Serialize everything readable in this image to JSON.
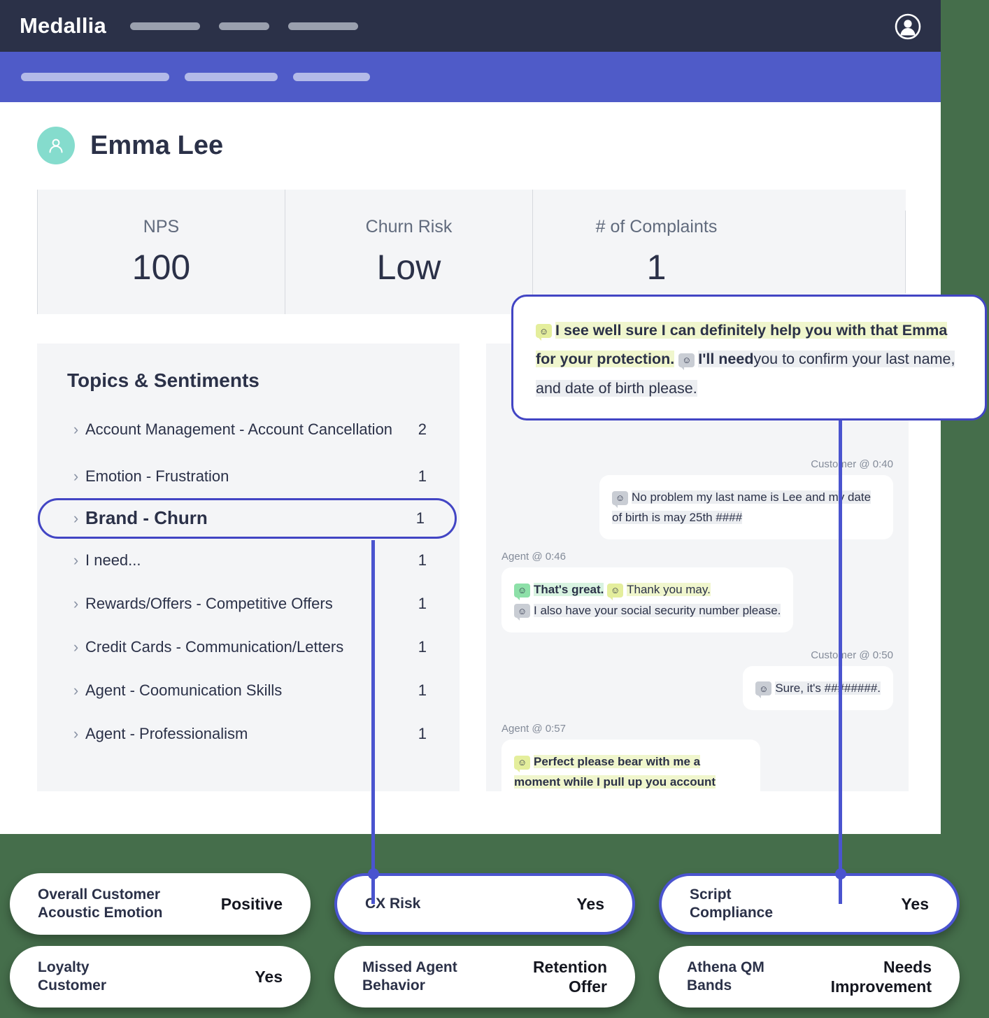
{
  "app": {
    "brand": "Medallia",
    "account_icon": "user-circle-icon",
    "nav_placeholders": 3,
    "subnav_placeholders": 3
  },
  "person": {
    "name": "Emma Lee",
    "avatar_icon": "person-icon"
  },
  "kpis": [
    {
      "label": "NPS",
      "value": "100"
    },
    {
      "label": "Churn Risk",
      "value": "Low"
    },
    {
      "label": "# of Complaints",
      "value": "1"
    }
  ],
  "topics_panel": {
    "title": "Topics & Sentiments",
    "expand_icon": "chevron-right-icon",
    "items": [
      {
        "label": "Account Management - Account Cancellation",
        "count": "2",
        "highlighted": false
      },
      {
        "label": "Emotion - Frustration",
        "count": "1",
        "highlighted": false
      },
      {
        "label": "Brand - Churn",
        "count": "1",
        "highlighted": true
      },
      {
        "label": "I need...",
        "count": "1",
        "highlighted": false
      },
      {
        "label": "Rewards/Offers - Competitive Offers",
        "count": "1",
        "highlighted": false
      },
      {
        "label": "Credit Cards - Communication/Letters",
        "count": "1",
        "highlighted": false
      },
      {
        "label": "Agent - Coomunication Skills",
        "count": "1",
        "highlighted": false
      },
      {
        "label": "Agent - Professionalism",
        "count": "1",
        "highlighted": false
      }
    ]
  },
  "callout": {
    "sentiment_icon": "smiley-chip-icon",
    "segments": [
      {
        "text": "I see well sure I can definitely help you with that Emma for your protection.",
        "style": "lime-bold"
      },
      {
        "text": "I'll need",
        "style": "grey-bold"
      },
      {
        "text": "you to confirm your last name, and date of birth please.",
        "style": "grey"
      }
    ],
    "full_text": "I see well sure I can definitely help you with that Emma for your protection. I'll need you to confirm your last name, and date of birth please."
  },
  "transcript": {
    "messages": [
      {
        "speaker": "Customer",
        "meta": "Customer @ 0:40",
        "side": "right",
        "lines": [
          {
            "chip": "grey",
            "text": "No problem my last name is Lee and my date of birth is may 25th ####",
            "style": "grey"
          }
        ]
      },
      {
        "speaker": "Agent",
        "meta": "Agent @ 0:46",
        "side": "left",
        "lines": [
          {
            "chip": "green",
            "text": "That's great.",
            "style": "green-bold"
          },
          {
            "chip": "lime",
            "text": "Thank you may.",
            "style": "lime"
          },
          {
            "chip": "grey",
            "text": "I also have your social security number please.",
            "style": "grey"
          }
        ]
      },
      {
        "speaker": "Customer",
        "meta": "Customer @ 0:50",
        "side": "right",
        "lines": [
          {
            "chip": "grey",
            "text": "Sure, it's ########.",
            "style": "grey"
          }
        ]
      },
      {
        "speaker": "Agent",
        "meta": "Agent @ 0:57",
        "side": "left",
        "lines": [
          {
            "chip": "lime",
            "text": "Perfect please bear with me a moment while I pull up you account",
            "style": "lime-bold"
          }
        ]
      }
    ]
  },
  "insight_pills": {
    "row1": [
      {
        "label": "Overall Customer\nAcoustic Emotion",
        "value": "Positive",
        "outlined": false
      },
      {
        "label": "CX Risk",
        "value": "Yes",
        "outlined": true
      },
      {
        "label": "Script\nCompliance",
        "value": "Yes",
        "outlined": true
      }
    ],
    "row2": [
      {
        "label": "Loyalty\nCustomer",
        "value": "Yes",
        "outlined": false
      },
      {
        "label": "Missed Agent\nBehavior",
        "value": "Retention\nOffer",
        "outlined": false
      },
      {
        "label": "Athena QM\nBands",
        "value": "Needs\nImprovement",
        "outlined": false
      }
    ]
  },
  "colors": {
    "background_green": "#456E4B",
    "topbar_dark": "#2b3148",
    "subnav_blue": "#4f5bc8",
    "accent_indigo": "#4245c4",
    "avatar_teal": "#85DCCD",
    "panel_grey": "#f4f5f7",
    "highlight_lime": "#f0f6cd",
    "highlight_green": "#d8f3e0",
    "highlight_grey": "#eceef1"
  }
}
